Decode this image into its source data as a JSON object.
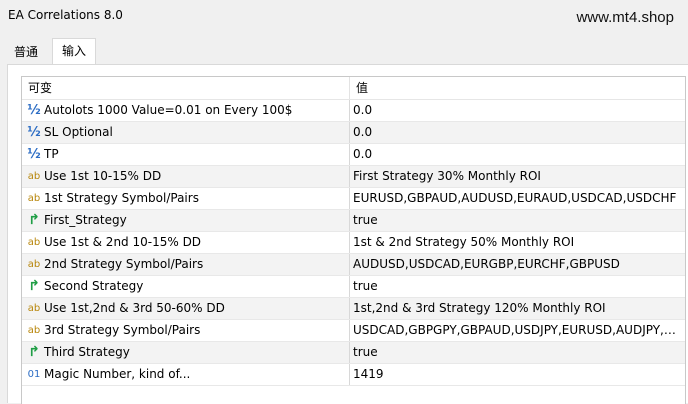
{
  "window": {
    "title": "EA Correlations 8.0"
  },
  "watermark": "www.mt4.shop",
  "tabs": [
    {
      "label": "普通"
    },
    {
      "label": "输入"
    }
  ],
  "table": {
    "headers": {
      "variable": "可变",
      "value": "值"
    },
    "rows": [
      {
        "icon": "double-icon",
        "glyph": "½",
        "name": "Autolots 1000 Value=0.01 on Every 100$",
        "value": "0.0"
      },
      {
        "icon": "double-icon",
        "glyph": "½",
        "name": "SL Optional",
        "value": "0.0"
      },
      {
        "icon": "double-icon",
        "glyph": "½",
        "name": "TP",
        "value": "0.0"
      },
      {
        "icon": "string-icon",
        "glyph": "ab",
        "name": "Use 1st 10-15% DD",
        "value": "First Strategy 30% Monthly ROI"
      },
      {
        "icon": "string-icon",
        "glyph": "ab",
        "name": "1st Strategy Symbol/Pairs",
        "value": "EURUSD,GBPAUD,AUDUSD,EURAUD,USDCAD,USDCHF"
      },
      {
        "icon": "bool-icon",
        "glyph": "↱",
        "name": "First_Strategy",
        "value": "true"
      },
      {
        "icon": "string-icon",
        "glyph": "ab",
        "name": "Use 1st & 2nd 10-15% DD",
        "value": "1st & 2nd Strategy 50% Monthly ROI"
      },
      {
        "icon": "string-icon",
        "glyph": "ab",
        "name": "2nd Strategy Symbol/Pairs",
        "value": "AUDUSD,USDCAD,EURGBP,EURCHF,GBPUSD"
      },
      {
        "icon": "bool-icon",
        "glyph": "↱",
        "name": "Second Strategy",
        "value": "true"
      },
      {
        "icon": "string-icon",
        "glyph": "ab",
        "name": "Use 1st,2nd & 3rd 50-60% DD",
        "value": "1st,2nd & 3rd Strategy 120% Monthly ROI"
      },
      {
        "icon": "string-icon",
        "glyph": "ab",
        "name": "3rd Strategy Symbol/Pairs",
        "value": "USDCAD,GBPGPY,GBPAUD,USDJPY,EURUSD,AUDJPY,A..."
      },
      {
        "icon": "bool-icon",
        "glyph": "↱",
        "name": "Third Strategy",
        "value": "true"
      },
      {
        "icon": "integer-icon",
        "glyph": "01",
        "name": "Magic Number, kind of...",
        "value": "1419"
      }
    ]
  }
}
